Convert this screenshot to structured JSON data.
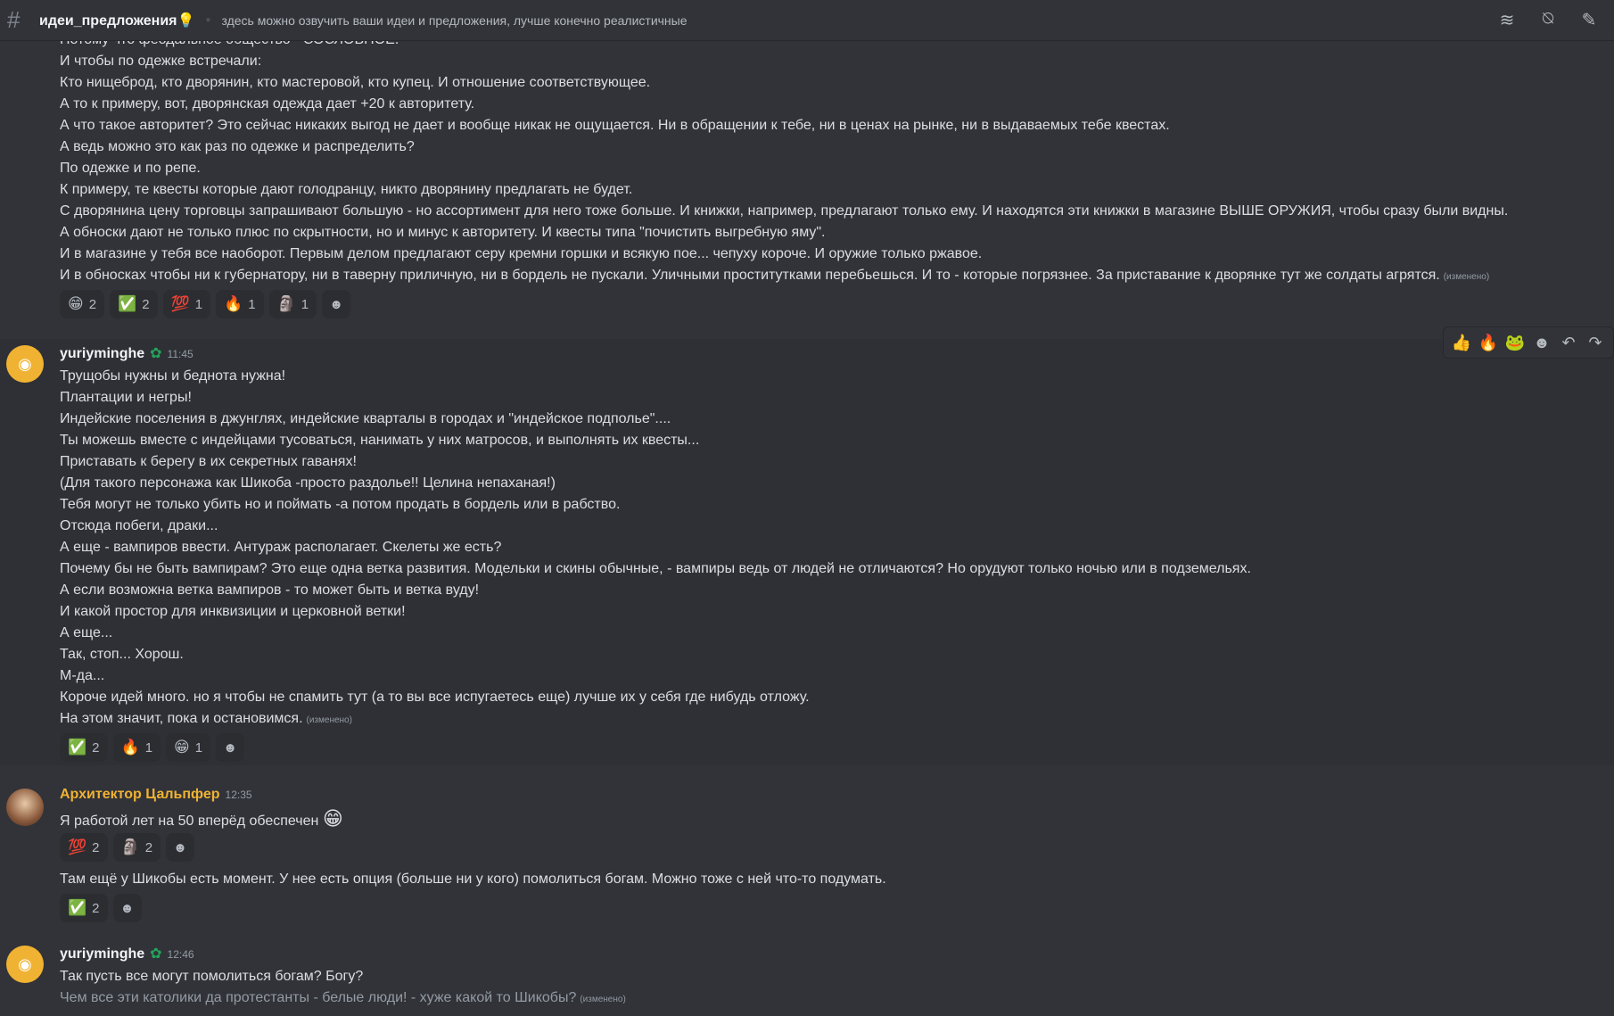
{
  "header": {
    "channel_name": "идеи_предложения💡",
    "topic": "здесь можно озвучить ваши идеи и предложения, лучше конечно реалистичные",
    "icons": [
      "threads-icon",
      "notifications-muted-icon",
      "pin-icon"
    ]
  },
  "message1": {
    "lines": [
      "Потому что феодальное общество - СОСЛОВНОЕ.",
      "И чтобы по одежке встречали:",
      "Кто нищеброд, кто дворянин, кто мастеровой, кто купец. И отношение соответствующее.",
      "А то к примеру, вот, дворянская одежда дает +20 к авторитету.",
      "А что такое авторитет? Это сейчас никаких выгод не дает и вообще никак не ощущается. Ни в обращении к тебе, ни в ценах на рынке, ни в выдаваемых тебе квестах.",
      "А ведь можно это как раз по одежке и распределить?",
      "По одежке и по репе.",
      "К примеру, те квесты которые дают голодранцу, никто дворянину предлагать не будет.",
      "С дворянина цену торговцы запрашивают большую - но ассортимент для него тоже больше. И книжки, например, предлагают только ему. И находятся эти книжки в магазине ВЫШЕ ОРУЖИЯ, чтобы сразу были видны.",
      "А обноски дают не только плюс по скрытности, но и минус к авторитету. И квесты типа \"почистить выгребную яму\".",
      "И в магазине у тебя все наоборот. Первым делом предлагают серу кремни горшки и всякую пое... чепуху короче. И оружие только ржавое.",
      "И в обносках чтобы ни к губернатору, ни в таверну приличную, ни в бордель не пускали. Уличными проститутками перебьешься. И то  - которые погрязнее. За приставание к дворянке тут же солдаты агрятся."
    ],
    "edited": "(изменено)",
    "reactions": [
      {
        "emoji": "😁",
        "count": "2"
      },
      {
        "emoji": "✅",
        "count": "2"
      },
      {
        "emoji": "💯",
        "count": "1"
      },
      {
        "emoji": "🔥",
        "count": "1"
      },
      {
        "emoji": "🗿",
        "count": "1"
      }
    ]
  },
  "message2": {
    "author": "yuriyminghe",
    "time": "11:45",
    "lines": [
      "Трущобы нужны и беднота нужна!",
      "Плантации и негры!",
      "Индейские поселения в джунглях, индейские кварталы в городах и \"индейское подполье\"....",
      "Ты можешь вместе с индейцами тусоваться, нанимать у них матросов, и выполнять их квесты...",
      "Приставать к берегу в их секретных гаванях!",
      "(Для такого персонажа как Шикоба -просто раздолье!! Целина непаханая!)",
      "Тебя могут не только убить но и поймать -а потом продать в бордель или в рабство.",
      "Отсюда побеги, драки...",
      "А еще - вампиров ввести. Антураж располагает. Скелеты же есть?",
      "Почему бы не быть вампирам? Это еще одна ветка развития. Модельки и скины обычные,  - вампиры ведь от людей не отличаются? Но орудуют только ночью или в подземельях.",
      "А если возможна ветка вампиров - то может быть и ветка вуду!",
      "И какой простор для инквизиции и церковной ветки!",
      "А еще...",
      "Так, стоп... Хорош.",
      "М-да...",
      "Короче идей много. но я чтобы не спамить тут (а то вы все испугаетесь еще) лучше их у себя где нибудь отложу.",
      "На этом значит, пока и остановимся."
    ],
    "edited": "(изменено)",
    "reactions": [
      {
        "emoji": "✅",
        "count": "2"
      },
      {
        "emoji": "🔥",
        "count": "1"
      },
      {
        "emoji": "😁",
        "count": "1"
      }
    ],
    "toolbar": [
      "👍",
      "🔥",
      "🐸"
    ]
  },
  "message3": {
    "author": "Архитектор Цальпфер",
    "time": "12:35",
    "text1": "Я работой лет на 50 вперёд обеспечен",
    "emoji1": "😁",
    "reactions1": [
      {
        "emoji": "💯",
        "count": "2"
      },
      {
        "emoji": "🗿",
        "count": "2"
      }
    ],
    "text2": "Там ещё у Шикобы есть момент. У нее есть опция (больше ни у кого) помолиться богам. Можно тоже с ней что-то подумать.",
    "reactions2": [
      {
        "emoji": "✅",
        "count": "2"
      }
    ]
  },
  "message4": {
    "author": "yuriyminghe",
    "time": "12:46",
    "line1": "Так пусть все могут помолиться богам? Богу?",
    "line2": "Чем все эти католики да протестанты - белые люди! - хуже какой то Шикобы?",
    "edited": "(изменено)"
  }
}
